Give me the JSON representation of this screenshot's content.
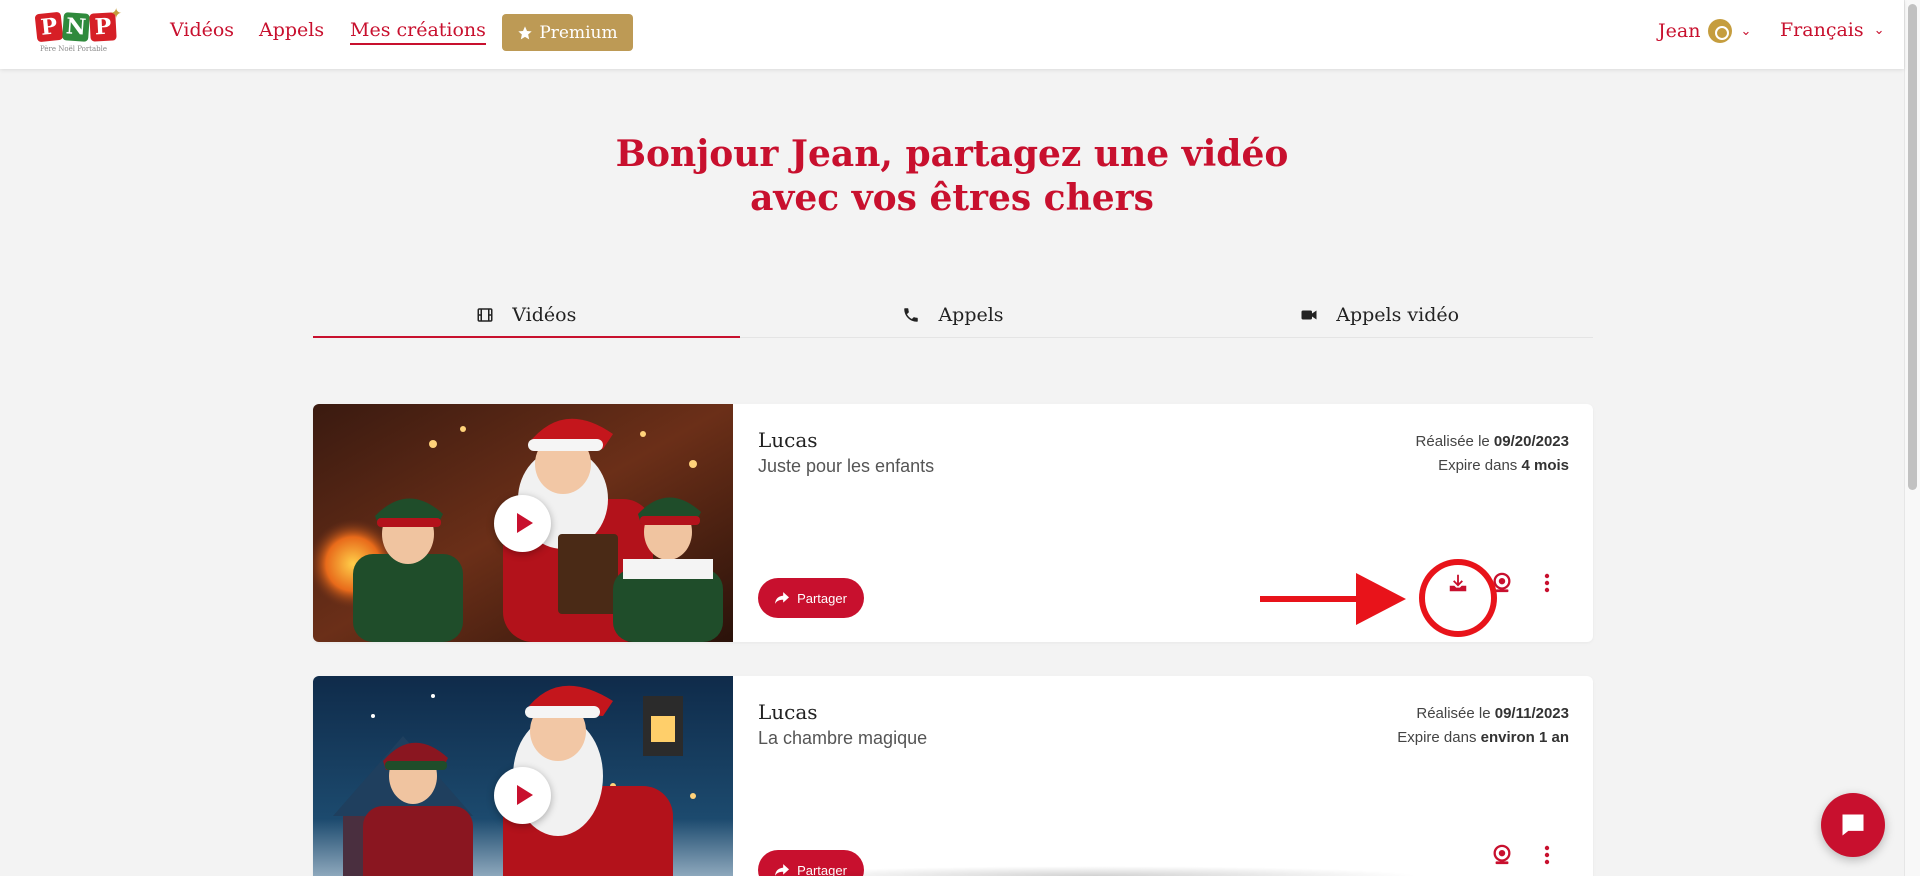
{
  "brand": {
    "logo_letters": [
      "P",
      "N",
      "P"
    ],
    "logo_tagline": "Père Noël Portable",
    "red": "#c8102e",
    "gold": "#bd9a55",
    "green": "#2f8a3c"
  },
  "nav": {
    "links": [
      {
        "label": "Vidéos"
      },
      {
        "label": "Appels"
      },
      {
        "label": "Mes créations",
        "active": true
      }
    ],
    "premium_label": "Premium",
    "user_name": "Jean",
    "language": "Français"
  },
  "page": {
    "title_line1": "Bonjour Jean, partagez une vidéo",
    "title_line2": "avec vos êtres chers"
  },
  "tabs": [
    {
      "label": "Vidéos",
      "icon": "film-icon",
      "active": true
    },
    {
      "label": "Appels",
      "icon": "phone-icon"
    },
    {
      "label": "Appels vidéo",
      "icon": "video-camera-icon"
    }
  ],
  "creations": [
    {
      "name": "Lucas",
      "subtitle": "Juste pour les enfants",
      "made_prefix": "Réalisée le ",
      "made_date": "09/20/2023",
      "expires_prefix": "Expire dans ",
      "expires_value": "4 mois",
      "share_label": "Partager"
    },
    {
      "name": "Lucas",
      "subtitle": "La chambre magique",
      "made_prefix": "Réalisée le ",
      "made_date": "09/11/2023",
      "expires_prefix": "Expire dans ",
      "expires_value": "environ 1 an",
      "share_label": "Partager"
    }
  ],
  "annotation": {
    "arrow_color": "#e8131a",
    "highlighted_control": "download-icon"
  }
}
